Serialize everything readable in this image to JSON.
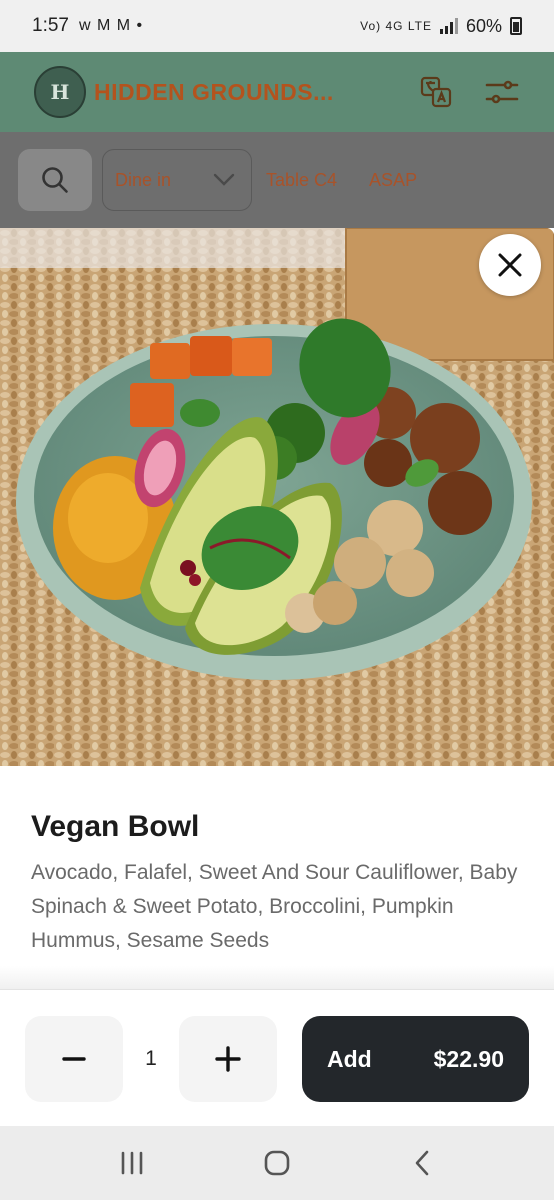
{
  "status_bar": {
    "time": "1:57",
    "notification_glyphs": "w M M •",
    "network": "Vo) 4G LTE",
    "battery": "60%"
  },
  "header": {
    "logo_letter": "H",
    "title": "HIDDEN GROUNDS...",
    "translate_icon": "translate-icon",
    "filter_icon": "sliders-icon"
  },
  "options": {
    "search_icon": "search-icon",
    "order_type": "Dine in",
    "table": "Table C4",
    "timing": "ASAP"
  },
  "item": {
    "name": "Vegan Bowl",
    "description": "Avocado, Falafel, Sweet And Sour Cauliflower, Baby Spinach & Sweet Potato, Broccolini, Pumpkin Hummus, Sesame Seeds"
  },
  "footer": {
    "quantity": "1",
    "add_label": "Add",
    "price": "$22.90"
  },
  "colors": {
    "header_bg": "#5e8a74",
    "brand_text": "#b4531d",
    "add_button_bg": "#23272b"
  }
}
